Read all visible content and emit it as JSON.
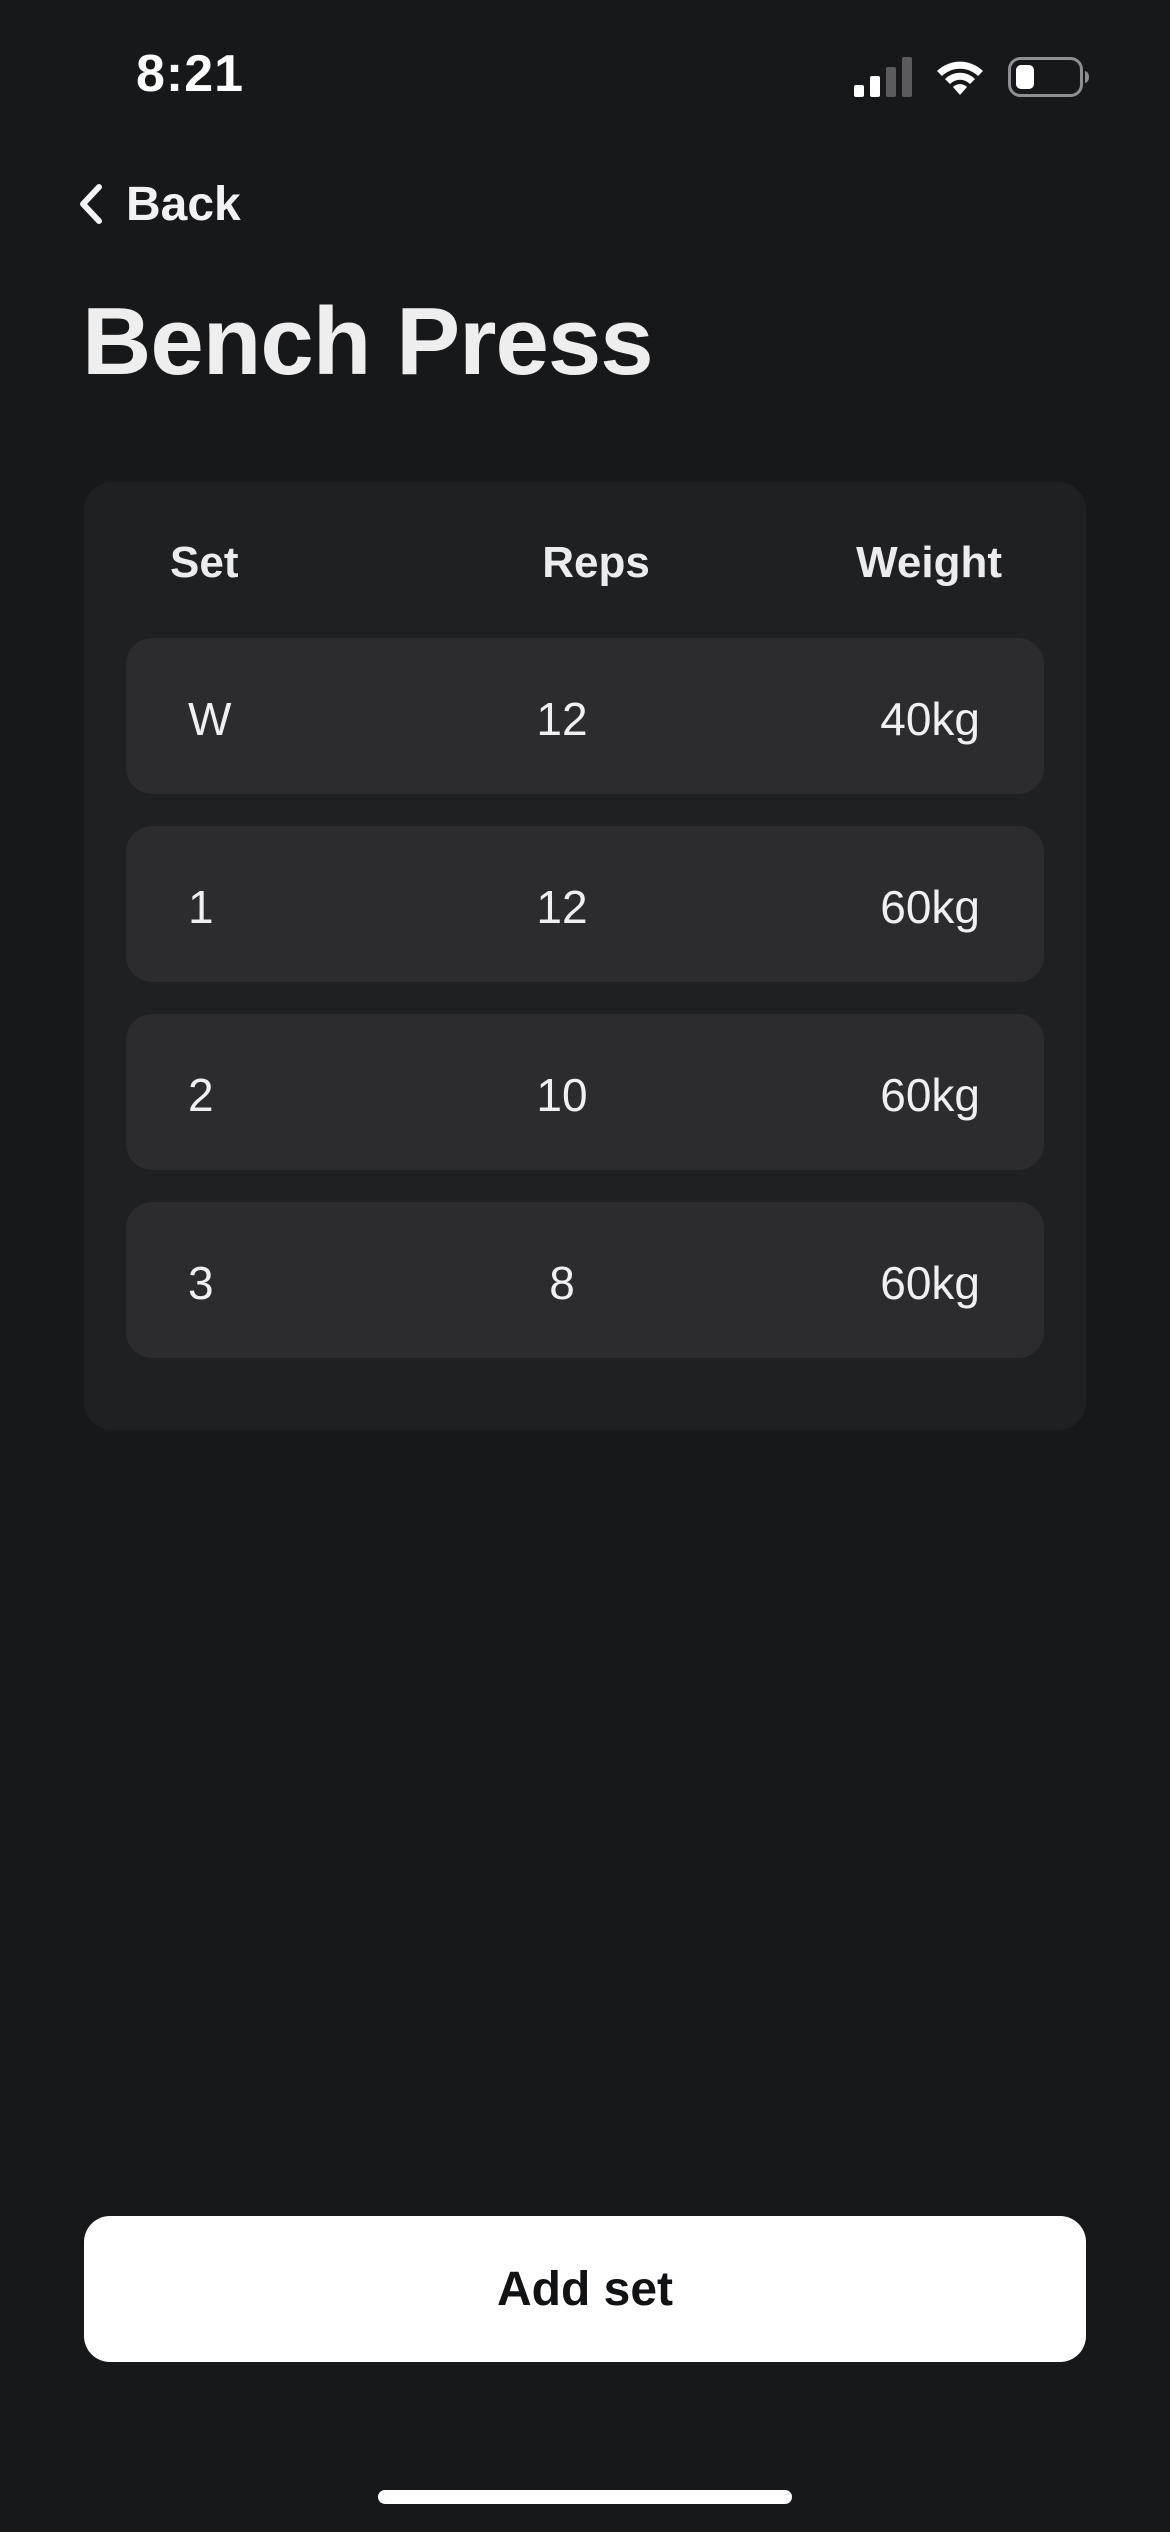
{
  "status_bar": {
    "time": "8:21",
    "icons": [
      "cellular-signal-icon",
      "wifi-icon",
      "battery-icon"
    ],
    "signal_bars_active": 2,
    "signal_bars_total": 4,
    "battery_level": 0.25
  },
  "nav": {
    "back_label": "Back",
    "back_icon": "chevron-left-icon"
  },
  "page": {
    "title": "Bench Press"
  },
  "sets_table": {
    "headers": {
      "set": "Set",
      "reps": "Reps",
      "weight": "Weight"
    },
    "rows": [
      {
        "set": "W",
        "reps": "12",
        "weight": "40kg"
      },
      {
        "set": "1",
        "reps": "12",
        "weight": "60kg"
      },
      {
        "set": "2",
        "reps": "10",
        "weight": "60kg"
      },
      {
        "set": "3",
        "reps": "8",
        "weight": "60kg"
      }
    ]
  },
  "actions": {
    "add_set_label": "Add set"
  },
  "colors": {
    "background": "#17181a",
    "card": "#1f2022",
    "row": "#2c2c2f",
    "text": "#f2f2f4",
    "button_bg": "#ffffff",
    "button_text": "#111214"
  }
}
